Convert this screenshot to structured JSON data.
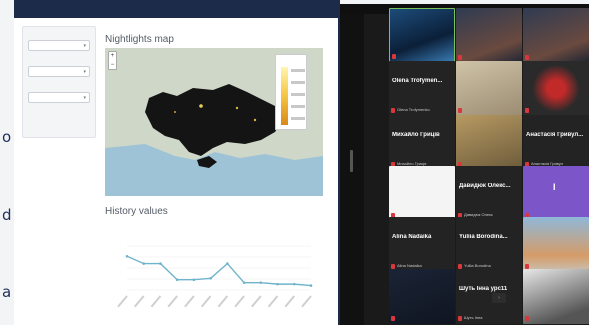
{
  "window": {
    "title_text": "",
    "edge_glyphs": [
      "o",
      "d",
      "a"
    ]
  },
  "sidebar": {
    "controls": [
      {
        "label": "",
        "value": ""
      },
      {
        "label": "",
        "value": ""
      },
      {
        "label": "",
        "value": ""
      }
    ]
  },
  "map": {
    "title": "Nightlights map",
    "zoom_in": "+",
    "zoom_out": "−",
    "legend_title": "",
    "attribution": ""
  },
  "history": {
    "title": "History values",
    "chart_data": {
      "type": "line",
      "title": "",
      "xlabel": "",
      "ylabel": "",
      "x": [
        "",
        "",
        "",
        "",
        "",
        "",
        "",
        "",
        "",
        "",
        "",
        ""
      ],
      "series": [
        {
          "values": [
            23,
            18,
            18,
            7,
            7,
            8,
            18,
            5,
            5,
            4,
            4,
            3
          ]
        }
      ],
      "ylim": [
        0,
        30
      ],
      "grid": true,
      "color": "#6fb4ca"
    }
  },
  "meeting": {
    "tiles": [
      {
        "name": "",
        "sub": "",
        "active": true,
        "kind": "space"
      },
      {
        "name": "",
        "sub": "",
        "active": false,
        "kind": "cam"
      },
      {
        "name": "",
        "sub": "",
        "active": false,
        "kind": "cam"
      },
      {
        "name": "Olena Trofymen...",
        "sub": "Olena Trofymenko",
        "active": false,
        "kind": "text"
      },
      {
        "name": "",
        "sub": "",
        "active": false,
        "kind": "room"
      },
      {
        "name": "",
        "sub": "",
        "active": false,
        "kind": "red"
      },
      {
        "name": "Михайло Гриців",
        "sub": "Михайло Гриців",
        "active": false,
        "kind": "text"
      },
      {
        "name": "",
        "sub": "",
        "active": false,
        "kind": "person"
      },
      {
        "name": "Анастасія Гривул...",
        "sub": "Анастасія Гривул",
        "active": false,
        "kind": "text"
      },
      {
        "name": "",
        "sub": "",
        "active": false,
        "kind": "white"
      },
      {
        "name": "Давидюк Олекс...",
        "sub": "Давидюк Олекс",
        "active": false,
        "kind": "text"
      },
      {
        "name": "I",
        "sub": "",
        "active": false,
        "kind": "purple"
      },
      {
        "name": "Alina Nadaika",
        "sub": "Alina Nadaika",
        "active": false,
        "kind": "text"
      },
      {
        "name": "Yuliia Borodina...",
        "sub": "Yuliia Borodina",
        "active": false,
        "kind": "text"
      },
      {
        "name": "",
        "sub": "",
        "active": false,
        "kind": "outdoor"
      },
      {
        "name": "",
        "sub": "",
        "active": false,
        "kind": "dark"
      },
      {
        "name": "Шуть Інна урс11",
        "sub": "Шуть Інна",
        "active": false,
        "kind": "text"
      },
      {
        "name": "",
        "sub": "",
        "active": false,
        "kind": "bw"
      }
    ],
    "pager": "›"
  }
}
